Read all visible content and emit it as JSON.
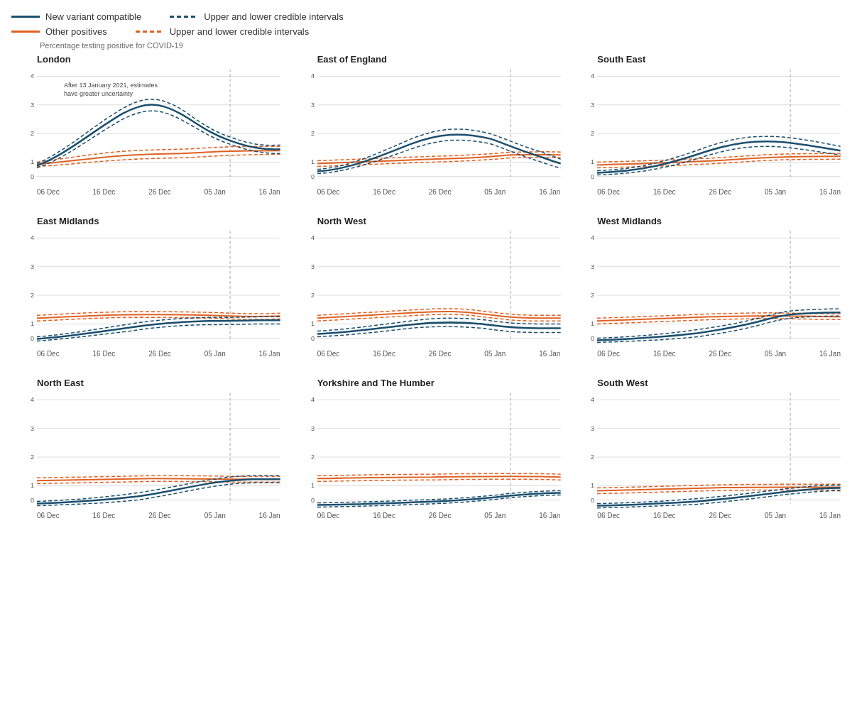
{
  "legend": {
    "row1": [
      {
        "label": "New variant compatible",
        "type": "solid-dark"
      },
      {
        "label": "Upper and lower credible intervals",
        "type": "dashed-dark"
      }
    ],
    "row2": [
      {
        "label": "Other positives",
        "type": "solid-orange"
      },
      {
        "label": "Upper and lower credible intervals",
        "type": "dashed-orange"
      }
    ]
  },
  "yAxisLabel": "Percentage testing positive for COVID-19",
  "xLabels": [
    "06 Dec",
    "16 Dec",
    "26 Dec",
    "05 Jan",
    "16 Jan"
  ],
  "charts": [
    {
      "title": "London",
      "note": "After 13 January 2021, estimates have greater uncertainty",
      "id": "london"
    },
    {
      "title": "East of England",
      "note": null,
      "id": "east_of_england"
    },
    {
      "title": "South East",
      "note": null,
      "id": "south_east"
    },
    {
      "title": "East Midlands",
      "note": null,
      "id": "east_midlands"
    },
    {
      "title": "North West",
      "note": null,
      "id": "north_west"
    },
    {
      "title": "West Midlands",
      "note": null,
      "id": "west_midlands"
    },
    {
      "title": "North East",
      "note": null,
      "id": "north_east"
    },
    {
      "title": "Yorkshire and The Humber",
      "note": null,
      "id": "yorkshire"
    },
    {
      "title": "South West",
      "note": null,
      "id": "south_west"
    }
  ]
}
